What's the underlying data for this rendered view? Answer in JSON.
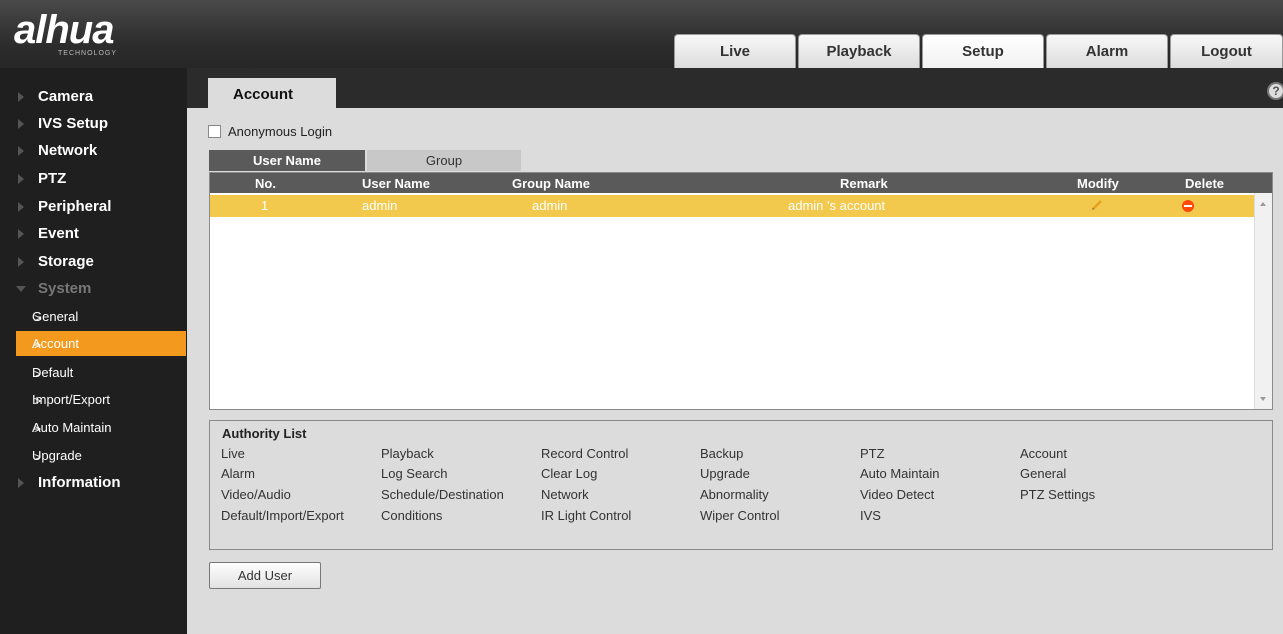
{
  "brand": {
    "logo": "alhua",
    "sub": "TECHNOLOGY"
  },
  "nav_tabs": [
    "Live",
    "Playback",
    "Setup",
    "Alarm",
    "Logout"
  ],
  "sidebar": {
    "items": [
      "Camera",
      "IVS Setup",
      "Network",
      "PTZ",
      "Peripheral",
      "Event",
      "Storage",
      "System"
    ],
    "system_subitems": [
      "General",
      "Account",
      "Default",
      "Import/Export",
      "Auto Maintain",
      "Upgrade"
    ],
    "after": "Information"
  },
  "page": {
    "tab": "Account",
    "help": "?"
  },
  "anonymous_login": {
    "label": "Anonymous Login",
    "checked": false
  },
  "subtabs": [
    "User Name",
    "Group"
  ],
  "table": {
    "headers": [
      "No.",
      "User Name",
      "Group Name",
      "Remark",
      "Modify",
      "Delete"
    ],
    "rows": [
      {
        "no": "1",
        "user": "admin",
        "group": "admin",
        "remark": "admin 's account"
      }
    ]
  },
  "authority": {
    "title": "Authority List",
    "items": [
      "Live",
      "Playback",
      "Record Control",
      "Backup",
      "PTZ",
      "Account",
      "Alarm",
      "Log Search",
      "Clear Log",
      "Upgrade",
      "Auto Maintain",
      "General",
      "Video/Audio",
      "Schedule/Destination",
      "Network",
      "Abnormality",
      "Video Detect",
      "PTZ Settings",
      "Default/Import/Export",
      "Conditions",
      "IR Light Control",
      "Wiper Control",
      "IVS"
    ]
  },
  "add_user_label": "Add User",
  "colors": {
    "accent": "#f39a1e",
    "selected_row": "#f2c94c",
    "delete": "#ff4a0a"
  }
}
